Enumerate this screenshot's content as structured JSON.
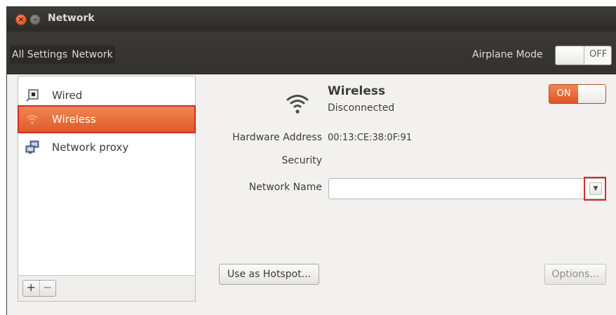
{
  "window": {
    "title": "Network",
    "close_glyph": "×",
    "minimize_glyph": "–"
  },
  "toolbar": {
    "breadcrumbs": [
      "All Settings",
      "Network"
    ],
    "airplane_mode_label": "Airplane Mode",
    "airplane_mode_state": "OFF"
  },
  "sidebar": {
    "items": [
      {
        "label": "Wired",
        "icon": "wired-icon",
        "selected": false
      },
      {
        "label": "Wireless",
        "icon": "wifi-icon",
        "selected": true
      },
      {
        "label": "Network proxy",
        "icon": "network-proxy-icon",
        "selected": false
      }
    ],
    "add_label": "+",
    "remove_label": "−"
  },
  "device": {
    "title": "Wireless",
    "status": "Disconnected",
    "power_state": "ON",
    "icon": "wifi-icon"
  },
  "properties": {
    "hardware_address_label": "Hardware Address",
    "hardware_address_value": "00:13:CE:38:0F:91",
    "security_label": "Security",
    "network_name_label": "Network Name",
    "network_name_value": "",
    "dropdown_arrow": "▼"
  },
  "buttons": {
    "hotspot_label": "Use as Hotspot...",
    "options_label": "Options..."
  },
  "colors": {
    "accent": "#dd4814",
    "highlight": "#d52a27",
    "titlebar": "#3c3b37"
  }
}
